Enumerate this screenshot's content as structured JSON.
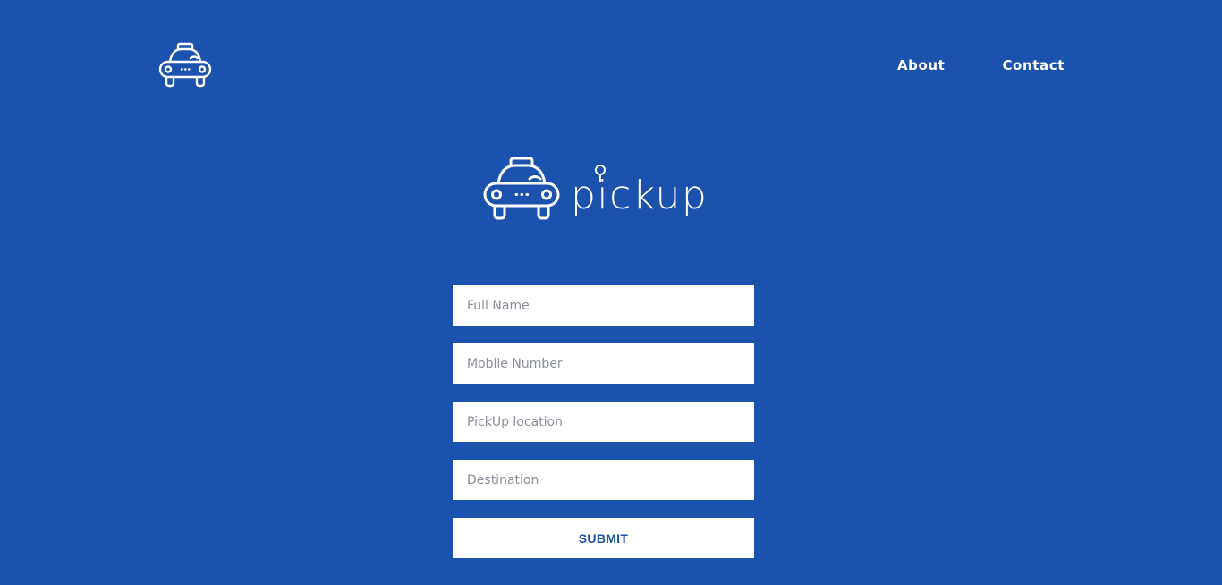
{
  "nav": {
    "items": [
      {
        "label": "About"
      },
      {
        "label": "Contact"
      }
    ]
  },
  "brand": {
    "name": "pickup",
    "icon": "taxi-icon"
  },
  "form": {
    "fields": [
      {
        "placeholder": "Full Name",
        "value": ""
      },
      {
        "placeholder": "Mobile Number",
        "value": ""
      },
      {
        "placeholder": "PickUp location",
        "value": ""
      },
      {
        "placeholder": "Destination",
        "value": ""
      }
    ],
    "submit_label": "SUBMIT"
  },
  "colors": {
    "background": "#1b52ad",
    "foreground": "#ffffff"
  }
}
